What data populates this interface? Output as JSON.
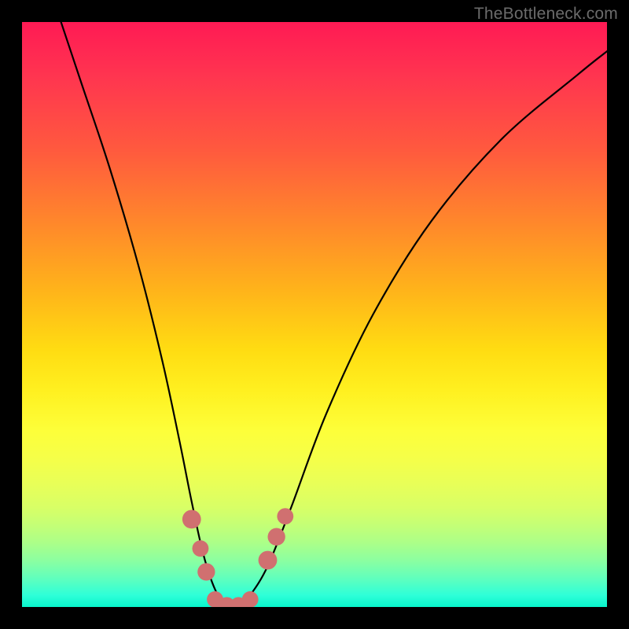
{
  "watermark": {
    "text": "TheBottleneck.com"
  },
  "chart_data": {
    "type": "line",
    "title": "",
    "xlabel": "",
    "ylabel": "",
    "xlim": [
      0,
      100
    ],
    "ylim": [
      0,
      100
    ],
    "background_gradient_top_color": "#ff1a54",
    "background_gradient_bottom_color": "#08f5cc",
    "series": [
      {
        "name": "bottleneck-curve",
        "color": "#000000",
        "x": [
          5,
          10,
          15,
          20,
          24,
          27,
          29,
          31,
          33,
          35,
          37,
          39,
          42,
          46,
          52,
          60,
          70,
          82,
          95,
          100
        ],
        "values": [
          105,
          90,
          75,
          58,
          42,
          28,
          18,
          9,
          3,
          0,
          0,
          2,
          7,
          17,
          33,
          50,
          66,
          80,
          91,
          95
        ]
      }
    ],
    "markers": [
      {
        "name": "marker-1",
        "x": 29.0,
        "y": 15.0,
        "r": 1.6,
        "color": "#d07070"
      },
      {
        "name": "marker-2",
        "x": 30.5,
        "y": 10.0,
        "r": 1.4,
        "color": "#d07070"
      },
      {
        "name": "marker-3",
        "x": 31.5,
        "y": 6.0,
        "r": 1.5,
        "color": "#d07070"
      },
      {
        "name": "marker-4",
        "x": 33.0,
        "y": 1.3,
        "r": 1.4,
        "color": "#d07070"
      },
      {
        "name": "marker-5",
        "x": 35.0,
        "y": 0.3,
        "r": 1.4,
        "color": "#d07070"
      },
      {
        "name": "marker-6",
        "x": 37.0,
        "y": 0.3,
        "r": 1.4,
        "color": "#d07070"
      },
      {
        "name": "marker-7",
        "x": 39.0,
        "y": 1.3,
        "r": 1.4,
        "color": "#d07070"
      },
      {
        "name": "marker-8",
        "x": 42.0,
        "y": 8.0,
        "r": 1.6,
        "color": "#d07070"
      },
      {
        "name": "marker-9",
        "x": 43.5,
        "y": 12.0,
        "r": 1.5,
        "color": "#d07070"
      },
      {
        "name": "marker-10",
        "x": 45.0,
        "y": 15.5,
        "r": 1.4,
        "color": "#d07070"
      }
    ]
  }
}
